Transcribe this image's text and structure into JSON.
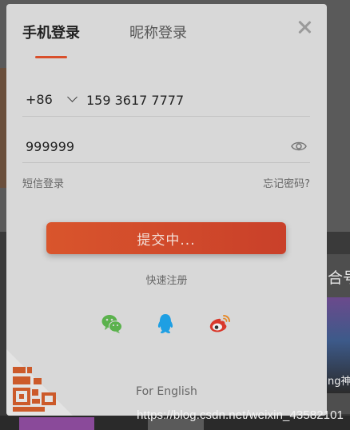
{
  "modal": {
    "tabs": [
      {
        "label": "手机登录",
        "active": true
      },
      {
        "label": "昵称登录",
        "active": false
      }
    ],
    "phone": {
      "country_code": "+86",
      "value": "159 3617 7777"
    },
    "password": {
      "value": "999999"
    },
    "sms_login_label": "短信登录",
    "forgot_label": "忘记密码?",
    "submit_label": "提交中...",
    "register_label": "快速注册",
    "social": [
      "wechat-icon",
      "qq-icon",
      "weibo-icon"
    ],
    "language_label": "For English"
  },
  "background": {
    "right_text": "合号",
    "right_caption": "ng神魔",
    "watermark": "https://blog.csdn.net/weixin_43582101"
  },
  "colors": {
    "accent": "#d94f2b",
    "modal_bg": "#d8d8d8",
    "wechat": "#5bb24d",
    "qq": "#1e9fe3",
    "weibo": "#d9382b"
  }
}
